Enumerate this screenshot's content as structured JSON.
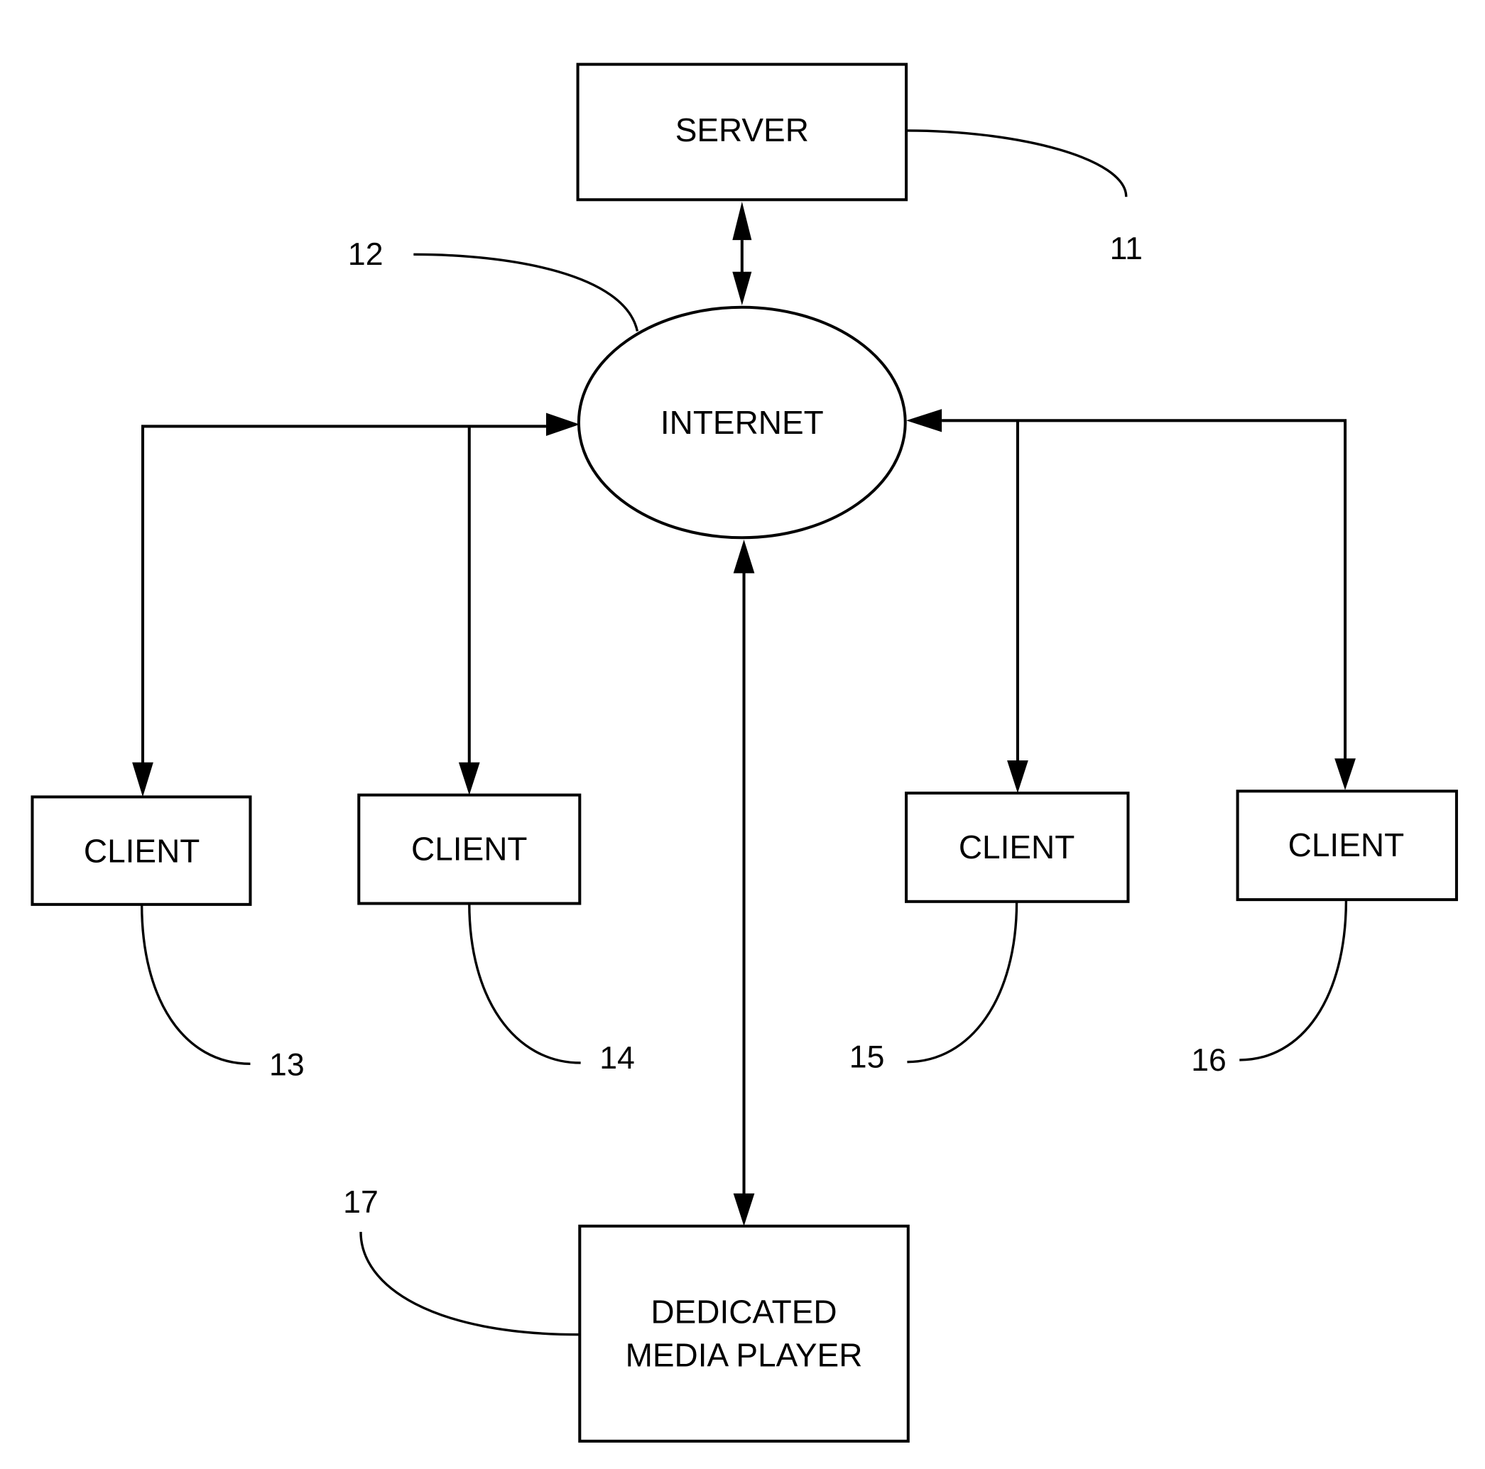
{
  "diagram": {
    "type": "network-block-diagram",
    "nodes": {
      "server": {
        "label": "SERVER",
        "ref": "11"
      },
      "internet": {
        "label": "INTERNET",
        "ref": "12"
      },
      "clients": [
        {
          "label": "CLIENT",
          "ref": "13"
        },
        {
          "label": "CLIENT",
          "ref": "14"
        },
        {
          "label": "CLIENT",
          "ref": "15"
        },
        {
          "label": "CLIENT",
          "ref": "16"
        }
      ],
      "media_player": {
        "label_line1": "DEDICATED",
        "label_line2": "MEDIA PLAYER",
        "ref": "17"
      }
    },
    "edges": [
      {
        "from": "SERVER",
        "to": "INTERNET",
        "direction": "bidirectional"
      },
      {
        "from": "INTERNET",
        "to": "CLIENT 13",
        "direction": "bidirectional"
      },
      {
        "from": "INTERNET",
        "to": "CLIENT 14",
        "direction": "bidirectional"
      },
      {
        "from": "INTERNET",
        "to": "CLIENT 15",
        "direction": "bidirectional"
      },
      {
        "from": "INTERNET",
        "to": "CLIENT 16",
        "direction": "bidirectional"
      },
      {
        "from": "INTERNET",
        "to": "DEDICATED MEDIA PLAYER",
        "direction": "bidirectional"
      }
    ]
  }
}
